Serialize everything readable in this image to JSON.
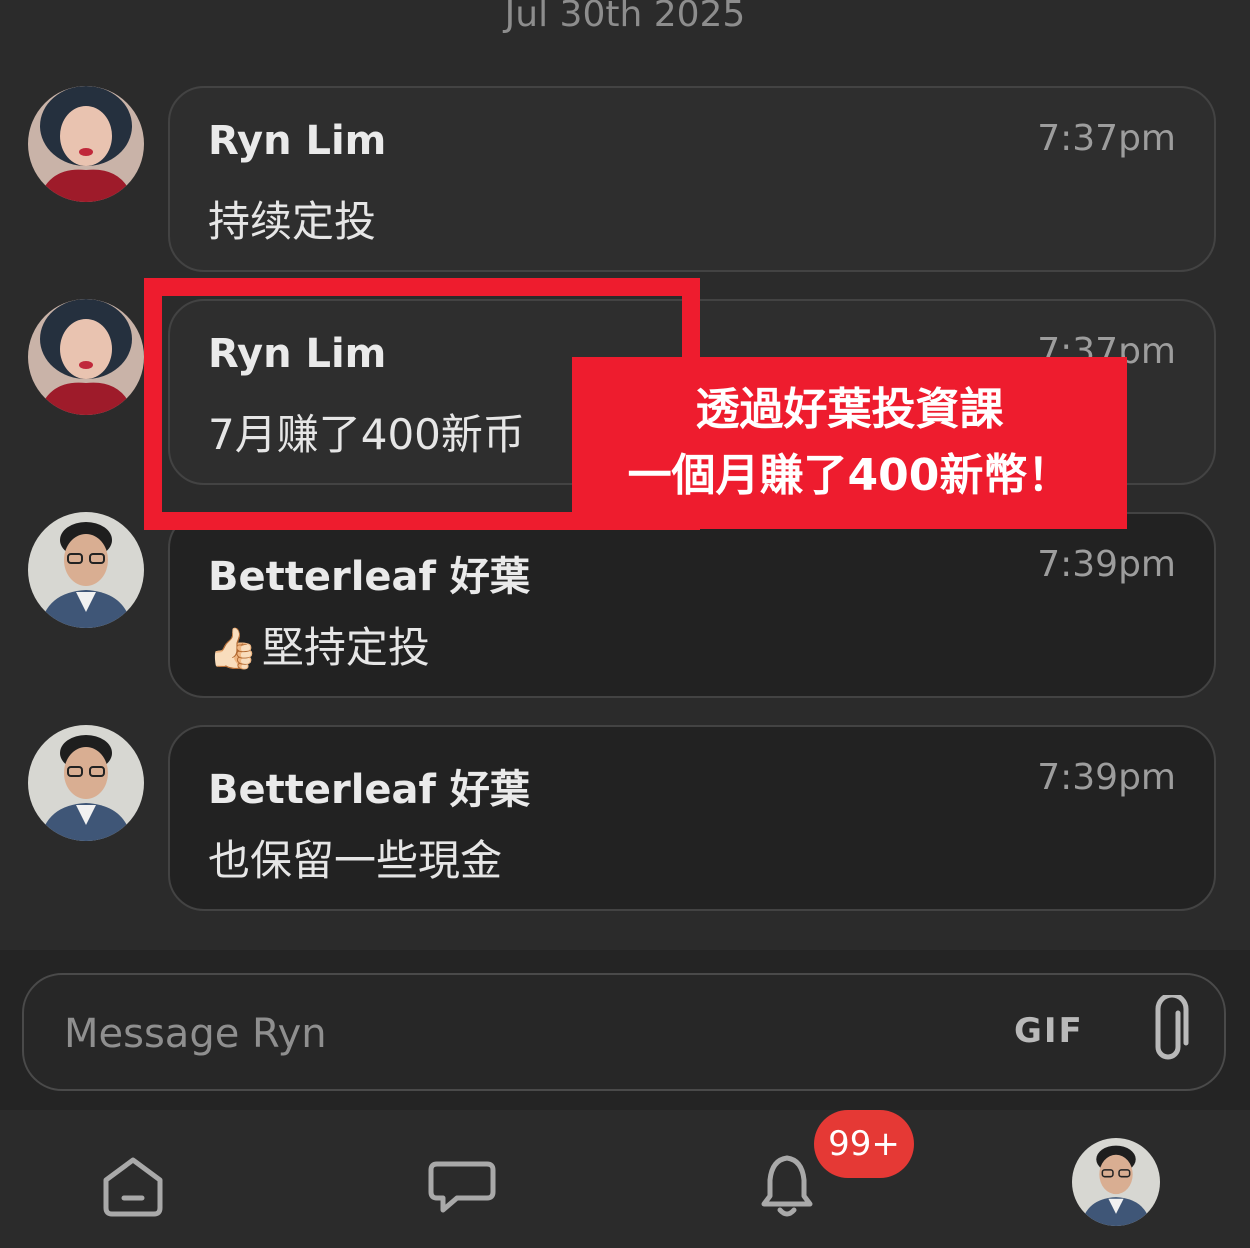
{
  "date_label": "Jul 30th 2025",
  "messages": [
    {
      "sender": "Ryn Lim",
      "time": "7:37pm",
      "text": "持续定投"
    },
    {
      "sender": "Ryn Lim",
      "time": "7:37pm",
      "text": "7月赚了400新币"
    },
    {
      "sender": "Betterleaf 好葉",
      "time": "7:39pm",
      "emoji": "👍🏻",
      "text": "堅持定投"
    },
    {
      "sender": "Betterleaf 好葉",
      "time": "7:39pm",
      "text": "也保留一些現金"
    }
  ],
  "promo": {
    "line1": "透過好葉投資課",
    "line2": "一個月賺了400新幣！"
  },
  "composer": {
    "placeholder": "Message Ryn",
    "gif_label": "GIF"
  },
  "nav": {
    "notification_badge": "99+"
  },
  "colors": {
    "accent_red": "#ee1c2e",
    "badge_red": "#e53935"
  }
}
